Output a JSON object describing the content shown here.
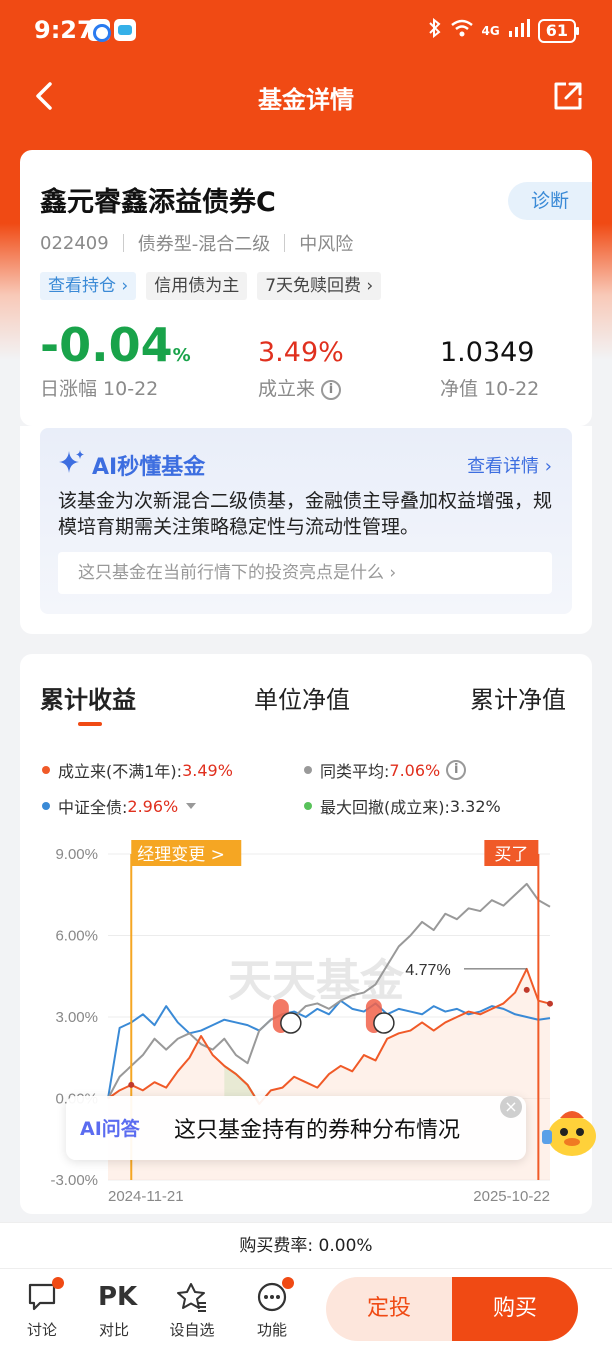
{
  "status": {
    "time": "9:27",
    "network": "4G",
    "battery": "61"
  },
  "nav": {
    "title": "基金详情"
  },
  "fund": {
    "name": "鑫元睿鑫添益债券C",
    "diagnose_label": "诊断",
    "code": "022409",
    "type": "债券型-混合二级",
    "risk": "中风险",
    "tags": [
      "查看持仓 ›",
      "信用债为主",
      "7天免赎回费 ›"
    ],
    "daily_change": "-0.04",
    "daily_change_unit": "%",
    "daily_change_label": "日涨幅 10-22",
    "since_inception": "3.49%",
    "since_inception_label": "成立来",
    "nav_value": "1.0349",
    "nav_label": "净值 10-22"
  },
  "ai": {
    "title": "AI秒懂基金",
    "more": "查看详情",
    "desc": "该基金为次新混合二级债基，金融债主导叠加权益增强，规模培育期需关注策略稳定性与流动性管理。",
    "question": "这只基金在当前行情下的投资亮点是什么"
  },
  "chart": {
    "tabs": [
      "累计收益",
      "单位净值",
      "累计净值"
    ],
    "legend": {
      "fund_label": "成立来(不满1年):",
      "fund_value": "3.49%",
      "peer_label": "同类平均:",
      "peer_value": "7.06%",
      "index_label": "中证全债:",
      "index_value": "2.96%",
      "drawdown_label": "最大回撤(成立来):",
      "drawdown_value": "3.32%"
    },
    "colors": {
      "fund": "#f05a28",
      "peer": "#999999",
      "index": "#3a8ad6",
      "drawdown": "#58c25a"
    },
    "manager_change_label": "经理变更 >",
    "buy_label": "买了",
    "peak_label": "4.77%",
    "watermark": "天天基金",
    "ai_ask_label": "AI问答",
    "ai_ask_text": "这只基金持有的券种分布情况"
  },
  "chart_data": {
    "type": "line",
    "title": "累计收益",
    "x_labels": [
      "2024-11-21",
      "2025-10-22"
    ],
    "yticks": [
      "9.00%",
      "6.00%",
      "3.00%",
      "0.00%",
      "-3.00%"
    ],
    "ylim": [
      -3,
      9
    ],
    "series": [
      {
        "name": "成立来",
        "values": [
          0,
          0.3,
          0.5,
          0.3,
          0.6,
          0.4,
          1.0,
          1.5,
          2.3,
          1.6,
          1.2,
          0.9,
          0.5,
          -0.2,
          0.3,
          0.4,
          0.8,
          0.6,
          0.4,
          0.9,
          1.2,
          1.0,
          1.6,
          1.4,
          2.2,
          2.4,
          2.5,
          2.8,
          2.5,
          2.8,
          3.0,
          3.2,
          3.1,
          3.3,
          3.5,
          3.9,
          4.77,
          3.6,
          3.49
        ]
      },
      {
        "name": "同类平均",
        "values": [
          0,
          0.8,
          1.2,
          1.6,
          2.2,
          1.8,
          2.2,
          2.4,
          2.0,
          1.8,
          2.2,
          1.6,
          1.3,
          2.5,
          2.9,
          3.1,
          3.0,
          3.4,
          3.5,
          3.3,
          3.6,
          3.8,
          3.9,
          4.2,
          4.9,
          5.6,
          6.0,
          6.5,
          6.2,
          6.8,
          6.6,
          7.0,
          6.9,
          7.3,
          7.1,
          7.5,
          7.9,
          7.3,
          7.06
        ]
      },
      {
        "name": "中证全债",
        "values": [
          0,
          2.6,
          2.8,
          3.1,
          2.7,
          3.4,
          2.8,
          2.4,
          2.5,
          2.7,
          2.9,
          2.8,
          2.7,
          2.5,
          2.9,
          3.1,
          3.2,
          3.0,
          3.3,
          3.1,
          3.6,
          3.3,
          3.2,
          3.5,
          3.1,
          3.3,
          3.2,
          3.1,
          3.4,
          3.2,
          3.3,
          3.1,
          3.2,
          3.4,
          3.3,
          3.1,
          3.0,
          2.9,
          2.96
        ]
      }
    ]
  },
  "fee": {
    "text": "购买费率: 0.00%"
  },
  "bottom": {
    "items": [
      "讨论",
      "对比",
      "设自选",
      "功能"
    ],
    "pk": "PK",
    "dingtou": "定投",
    "buy": "购买"
  }
}
